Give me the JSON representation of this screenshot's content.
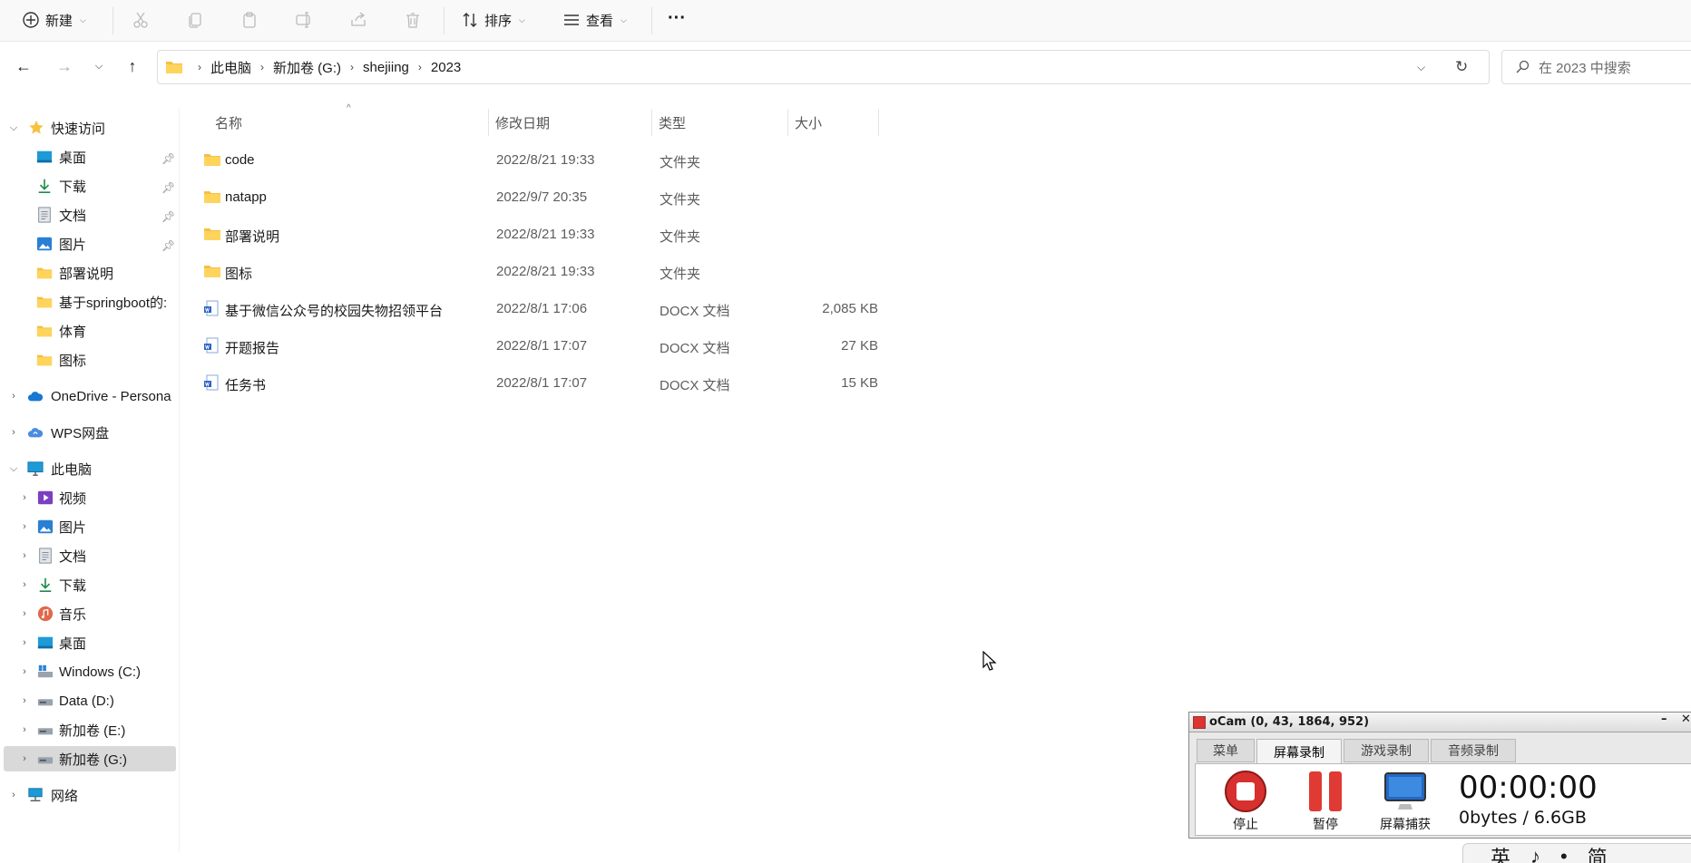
{
  "toolbar": {
    "new_label": "新建",
    "sort_label": "排序",
    "view_label": "查看",
    "more_label": "···"
  },
  "breadcrumb": [
    "此电脑",
    "新加卷 (G:)",
    "shejiing",
    "2023"
  ],
  "search": {
    "placeholder": "在 2023 中搜索"
  },
  "sidebar": {
    "quick_access": "快速访问",
    "quick_items": [
      {
        "label": "桌面",
        "icon": "desktop-icon",
        "pinned": true
      },
      {
        "label": "下载",
        "icon": "download-icon",
        "pinned": true
      },
      {
        "label": "文档",
        "icon": "document-icon",
        "pinned": true
      },
      {
        "label": "图片",
        "icon": "pictures-icon",
        "pinned": true
      },
      {
        "label": "部署说明",
        "icon": "folder-icon",
        "pinned": false
      },
      {
        "label": "基于springboot的:",
        "icon": "folder-icon",
        "pinned": false
      },
      {
        "label": "体育",
        "icon": "folder-icon",
        "pinned": false
      },
      {
        "label": "图标",
        "icon": "folder-icon",
        "pinned": false
      }
    ],
    "onedrive": "OneDrive - Persona",
    "wps": "WPS网盘",
    "this_pc": "此电脑",
    "pc_items": [
      {
        "label": "视频",
        "icon": "video-icon"
      },
      {
        "label": "图片",
        "icon": "pictures-icon"
      },
      {
        "label": "文档",
        "icon": "document-icon"
      },
      {
        "label": "下载",
        "icon": "download-icon"
      },
      {
        "label": "音乐",
        "icon": "music-icon"
      },
      {
        "label": "桌面",
        "icon": "desktop-icon"
      },
      {
        "label": "Windows (C:)",
        "icon": "drive-icon"
      },
      {
        "label": "Data (D:)",
        "icon": "drive-icon"
      },
      {
        "label": "新加卷 (E:)",
        "icon": "drive-icon"
      },
      {
        "label": "新加卷 (G:)",
        "icon": "drive-icon"
      }
    ],
    "network": "网络"
  },
  "columns": {
    "name": "名称",
    "date": "修改日期",
    "type": "类型",
    "size": "大小"
  },
  "files": [
    {
      "name": "code",
      "date": "2022/8/21 19:33",
      "type": "文件夹",
      "size": "",
      "kind": "folder"
    },
    {
      "name": "natapp",
      "date": "2022/9/7 20:35",
      "type": "文件夹",
      "size": "",
      "kind": "folder"
    },
    {
      "name": "部署说明",
      "date": "2022/8/21 19:33",
      "type": "文件夹",
      "size": "",
      "kind": "folder"
    },
    {
      "name": "图标",
      "date": "2022/8/21 19:33",
      "type": "文件夹",
      "size": "",
      "kind": "folder"
    },
    {
      "name": "基于微信公众号的校园失物招领平台",
      "date": "2022/8/1 17:06",
      "type": "DOCX 文档",
      "size": "2,085 KB",
      "kind": "docx"
    },
    {
      "name": "开题报告",
      "date": "2022/8/1 17:07",
      "type": "DOCX 文档",
      "size": "27 KB",
      "kind": "docx"
    },
    {
      "name": "任务书",
      "date": "2022/8/1 17:07",
      "type": "DOCX 文档",
      "size": "15 KB",
      "kind": "docx"
    }
  ],
  "ocam": {
    "title": "oCam (0, 43, 1864, 952)",
    "tabs": [
      "菜单",
      "屏幕录制",
      "游戏录制",
      "音频录制"
    ],
    "stop_label": "停止",
    "pause_label": "暂停",
    "capture_label": "屏幕捕获",
    "timer": "00:00:00",
    "size": "0bytes / 6.6GB"
  },
  "ime": [
    "英",
    "♪",
    "•",
    "简"
  ],
  "colors": {
    "folder": "#f5c042",
    "accent": "#0067c0",
    "selection": "#d9d9d9"
  }
}
